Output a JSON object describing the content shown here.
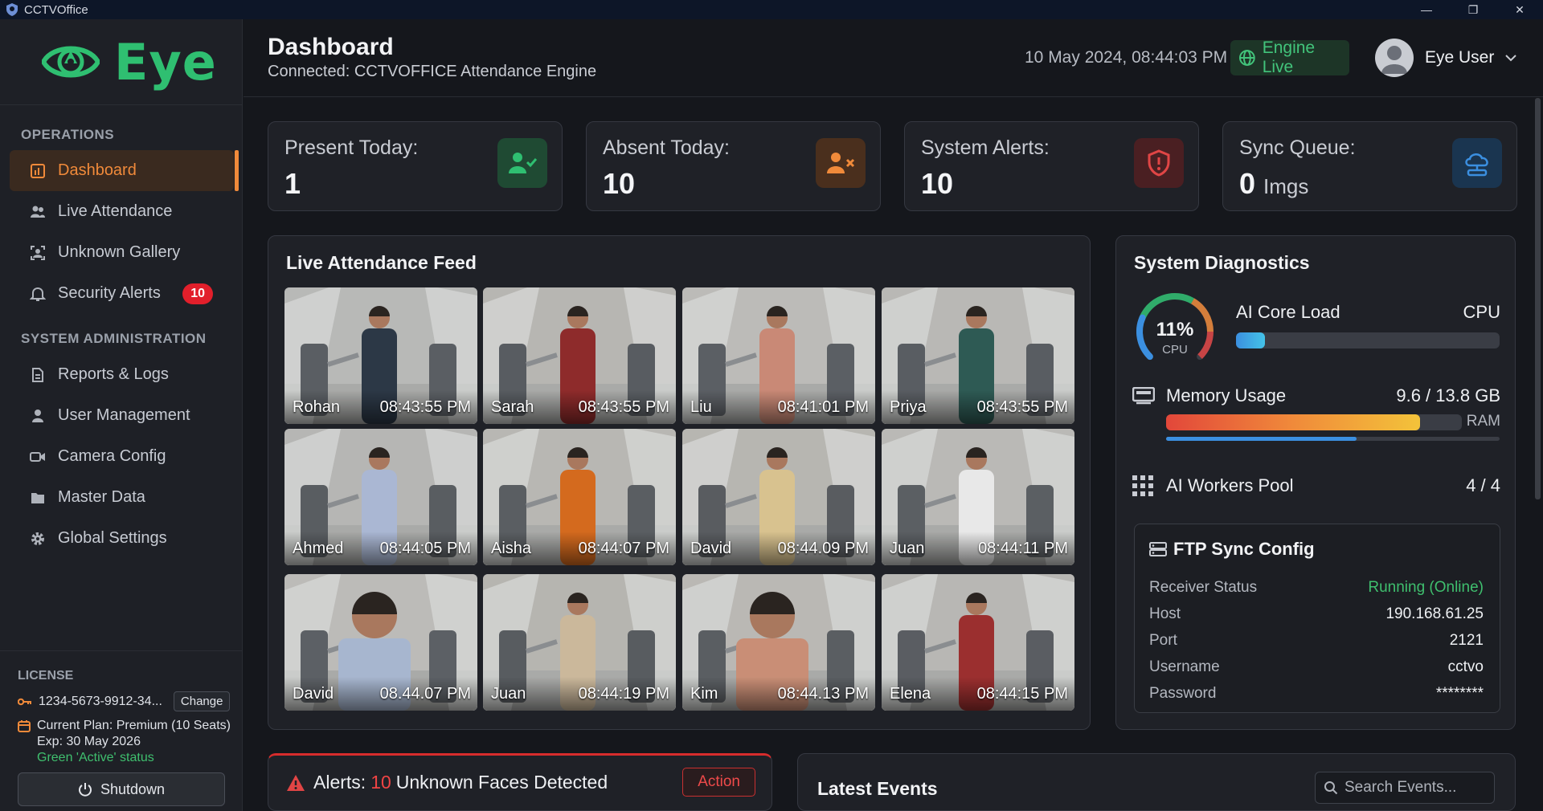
{
  "window": {
    "title": "CCTVOffice",
    "controls": [
      "—",
      "❐",
      "✕"
    ]
  },
  "logo": {
    "text": "Eye"
  },
  "sidebar": {
    "operations_title": "OPERATIONS",
    "operations": [
      {
        "label": "Dashboard",
        "active": true
      },
      {
        "label": "Live Attendance"
      },
      {
        "label": "Unknown Gallery"
      },
      {
        "label": "Security Alerts",
        "badge": "10"
      }
    ],
    "admin_title": "SYSTEM ADMINISTRATION",
    "admin": [
      {
        "label": "Reports & Logs"
      },
      {
        "label": "User Management"
      },
      {
        "label": "Camera Config"
      },
      {
        "label": "Master Data"
      },
      {
        "label": "Global Settings"
      }
    ],
    "license": {
      "title": "LICENSE",
      "key": "1234-5673-9912-34...",
      "change_label": "Change",
      "plan": "Current Plan: Premium (10 Seats)",
      "expiry": "Exp: 30 May 2026",
      "status": "Green 'Active' status"
    },
    "shutdown_label": "Shutdown"
  },
  "header": {
    "title": "Dashboard",
    "subtitle": "Connected: CCTVOFFICE Attendance Engine",
    "datetime": "10 May 2024, 08:44:03 PM",
    "engine_label": "Engine Live",
    "user_name": "Eye User"
  },
  "stats": [
    {
      "label": "Present Today:",
      "value": "1",
      "unit": "",
      "color": "#2fbf71",
      "icon": "user-check-icon"
    },
    {
      "label": "Absent Today:",
      "value": "10",
      "unit": "",
      "color": "#f08a3a",
      "icon": "user-x-icon"
    },
    {
      "label": "System Alerts:",
      "value": "10",
      "unit": "",
      "color": "#e04545",
      "icon": "shield-alert-icon"
    },
    {
      "label": "Sync Queue:",
      "value": "0",
      "unit": "Imgs",
      "color": "#3b8fe0",
      "icon": "cloud-sync-icon"
    }
  ],
  "feed": {
    "title": "Live Attendance Feed",
    "tiles": [
      {
        "name": "Rohan",
        "time": "08:43:55 PM"
      },
      {
        "name": "Sarah",
        "time": "08:43:55 PM"
      },
      {
        "name": "Liu",
        "time": "08:41:01 PM"
      },
      {
        "name": "Priya",
        "time": "08:43:55 PM"
      },
      {
        "name": "Ahmed",
        "time": "08:44:05 PM"
      },
      {
        "name": "Aisha",
        "time": "08:44:07 PM"
      },
      {
        "name": "David",
        "time": "08:44.09 PM"
      },
      {
        "name": "Juan",
        "time": "08:44:11 PM"
      },
      {
        "name": "David",
        "time": "08.44.07 PM"
      },
      {
        "name": "Juan",
        "time": "08:44:19 PM"
      },
      {
        "name": "Kim",
        "time": "08:44.13 PM"
      },
      {
        "name": "Elena",
        "time": "08:44:15 PM"
      }
    ]
  },
  "diagnostics": {
    "title": "System Diagnostics",
    "cpu_percent": "11%",
    "cpu_label": "CPU",
    "cpu_fraction": 0.11,
    "ai_core_label": "AI Core Load",
    "ai_core_unit": "CPU",
    "ai_core_fraction": 0.11,
    "memory_label": "Memory Usage",
    "memory_value": "9.6 / 13.8 GB",
    "memory_unit": "RAM",
    "memory_fraction": 0.7,
    "workers_label": "AI Workers Pool",
    "workers_value": "4 / 4",
    "ftp": {
      "title": "FTP Sync Config",
      "rows": [
        {
          "key": "Receiver Status",
          "value": "Running (Online)",
          "color": "#3fbf6e"
        },
        {
          "key": "Host",
          "value": "190.168.61.25"
        },
        {
          "key": "Port",
          "value": "2121"
        },
        {
          "key": "Username",
          "value": "cctvo"
        },
        {
          "key": "Password",
          "value": "********"
        }
      ]
    }
  },
  "alerts": {
    "prefix": "Alerts:",
    "count": "10",
    "suffix": "Unknown Faces Detected",
    "action_label": "Action"
  },
  "events": {
    "title": "Latest Events",
    "search_placeholder": "Search Events..."
  }
}
